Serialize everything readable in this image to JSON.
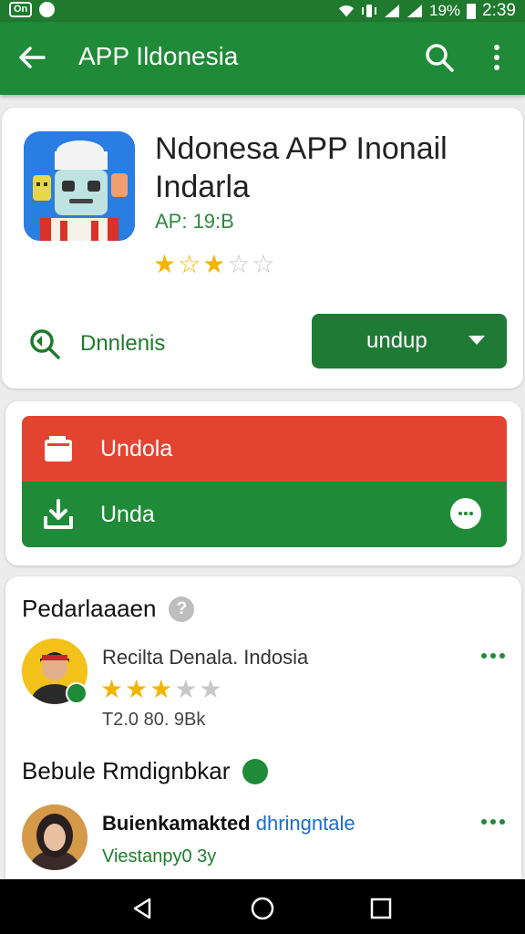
{
  "status_bar": {
    "badge": "On",
    "battery": "19%",
    "time": "2:39",
    "icons": [
      "notification-box-icon",
      "record-dot-icon",
      "wifi-icon",
      "vibrate-icon",
      "signal-icon",
      "signal-icon",
      "battery-icon"
    ]
  },
  "app_bar": {
    "title": "APP Ildonesia",
    "icons": [
      "back-arrow-icon",
      "search-icon",
      "more-vert-icon"
    ]
  },
  "app": {
    "name": "Ndonesa APP Inonail Indarla",
    "meta": "AP: 19:B",
    "rating": 2.5,
    "wishlist_label": "Dnnlenis",
    "install_label": "undup"
  },
  "actions": {
    "primary_label": "Undola",
    "secondary_label": "Unda"
  },
  "reviews": {
    "section_title": "Pedarlaaaen",
    "items": [
      {
        "name": "Recilta Denala. Indosia",
        "rating": 3,
        "date": "T2.0 80. 9Bk"
      }
    ],
    "section2_title": "Bebule Rmdignbkar",
    "items2": [
      {
        "name": "Buienkamakted",
        "link": "dhringntale",
        "sub": "Viestanpy0 3y"
      }
    ]
  },
  "colors": {
    "primary": "#1f8a37",
    "status_bar": "#1f7a2e",
    "accent_red": "#e34431",
    "star": "#f4b400",
    "link": "#1c6cc9"
  },
  "nav_bar": {
    "icons": [
      "back-triangle-icon",
      "home-circle-icon",
      "recents-square-icon"
    ]
  }
}
